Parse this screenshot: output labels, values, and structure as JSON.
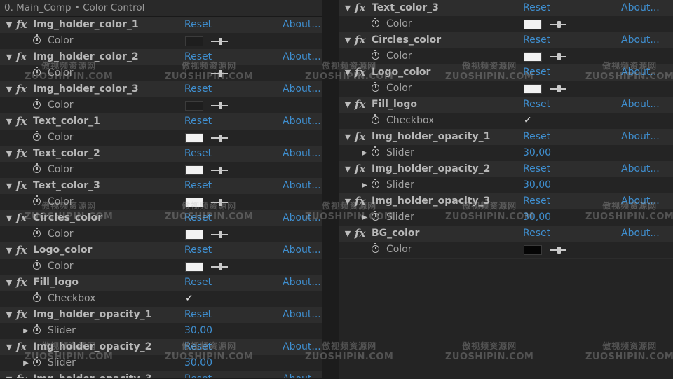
{
  "panel": {
    "title": "0. Main_Comp • Color Control"
  },
  "labels": {
    "reset": "Reset",
    "about": "About...",
    "checkmark": "✓"
  },
  "colors": {
    "link": "#3f8fd0",
    "swatch_dark": "#1e1e1e",
    "swatch_light": "#f2f2f2",
    "swatch_black": "#050505"
  },
  "left_effects": [
    {
      "name": "Img_holder_color_1",
      "param": "Color",
      "type": "color",
      "swatch": "#1e1e1e"
    },
    {
      "name": "Img_holder_color_2",
      "param": "Color",
      "type": "color",
      "swatch": "#1e1e1e"
    },
    {
      "name": "Img_holder_color_3",
      "param": "Color",
      "type": "color",
      "swatch": "#1e1e1e"
    },
    {
      "name": "Text_color_1",
      "param": "Color",
      "type": "color",
      "swatch": "#f2f2f2"
    },
    {
      "name": "Text_color_2",
      "param": "Color",
      "type": "color",
      "swatch": "#f2f2f2"
    },
    {
      "name": "Text_color_3",
      "param": "Color",
      "type": "color",
      "swatch": "#f2f2f2"
    },
    {
      "name": "Circles_color",
      "param": "Color",
      "type": "color",
      "swatch": "#f2f2f2"
    },
    {
      "name": "Logo_color",
      "param": "Color",
      "type": "color",
      "swatch": "#f2f2f2"
    },
    {
      "name": "Fill_logo",
      "param": "Checkbox",
      "type": "checkbox"
    },
    {
      "name": "Img_holder_opacity_1",
      "param": "Slider",
      "type": "slider",
      "value": "30,00"
    },
    {
      "name": "Img_holder_opacity_2",
      "param": "Slider",
      "type": "slider",
      "value": "30,00"
    },
    {
      "name": "Img_holder_opacity_3",
      "param": "",
      "type": "partial"
    }
  ],
  "right_effects": [
    {
      "name": "Text_color_3",
      "param": "Color",
      "type": "color",
      "swatch": "#f2f2f2"
    },
    {
      "name": "Circles_color",
      "param": "Color",
      "type": "color",
      "swatch": "#f2f2f2"
    },
    {
      "name": "Logo_color",
      "param": "Color",
      "type": "color",
      "swatch": "#f2f2f2"
    },
    {
      "name": "Fill_logo",
      "param": "Checkbox",
      "type": "checkbox"
    },
    {
      "name": "Img_holder_opacity_1",
      "param": "Slider",
      "type": "slider",
      "value": "30,00"
    },
    {
      "name": "Img_holder_opacity_2",
      "param": "Slider",
      "type": "slider",
      "value": "30,00"
    },
    {
      "name": "Img_holder_opacity_3",
      "param": "Slider",
      "type": "slider",
      "value": "30,00"
    },
    {
      "name": "BG_color",
      "param": "Color",
      "type": "color",
      "swatch": "#050505"
    }
  ],
  "watermark": {
    "cn": "傲视频资源网",
    "en": "ZUOSHIPIN.COM"
  }
}
